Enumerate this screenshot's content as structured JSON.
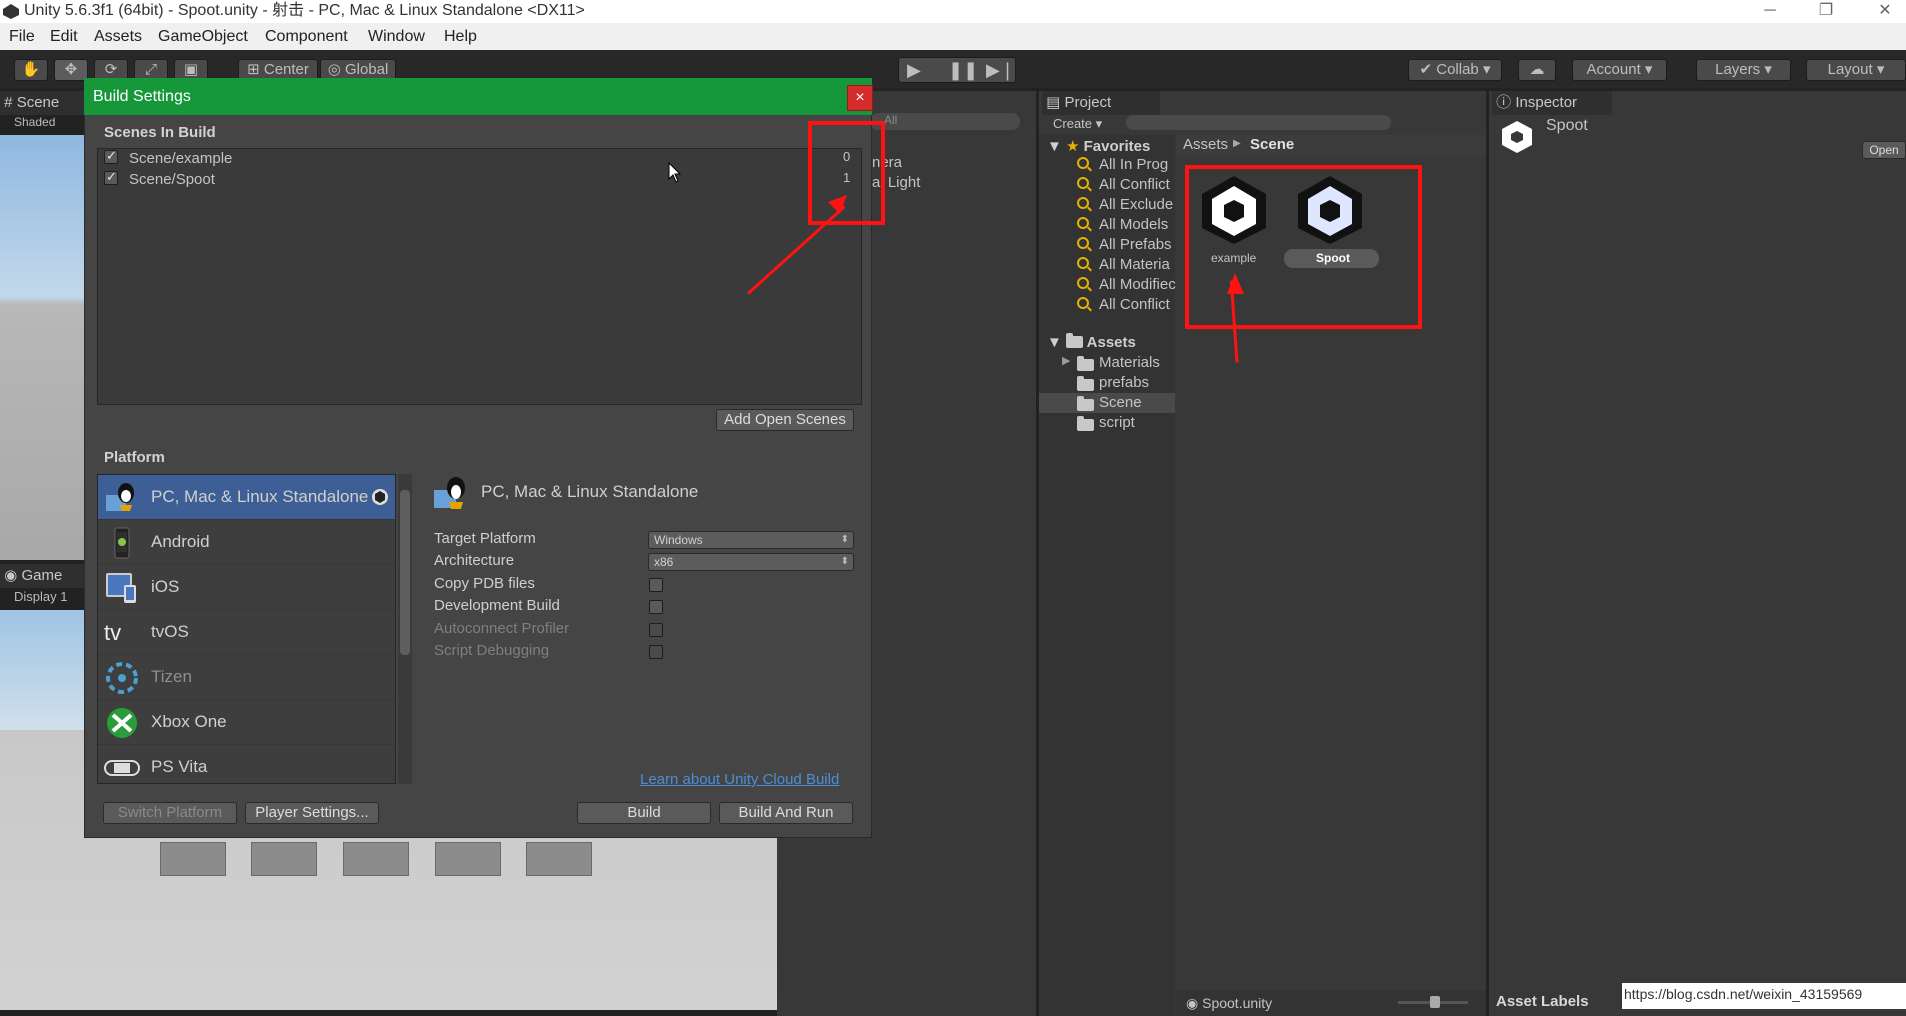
{
  "window": {
    "title": "Unity 5.6.3f1 (64bit) - Spoot.unity - 射击 - PC, Mac & Linux Standalone <DX11>"
  },
  "menu": [
    "File",
    "Edit",
    "Assets",
    "GameObject",
    "Component",
    "Window",
    "Help"
  ],
  "toolbar": {
    "pivot": "Center",
    "space": "Global",
    "collab": "Collab",
    "account": "Account",
    "layers": "Layers",
    "layout": "Layout"
  },
  "scene_tab": {
    "label": "Scene",
    "mode": "Shaded"
  },
  "game_tab": {
    "label": "Game",
    "display": "Display 1"
  },
  "hierarchy": {
    "search_placeholder": "All",
    "items": [
      "nera",
      "al Light"
    ]
  },
  "dialog": {
    "title": "Build Settings",
    "close": "×",
    "scenes_header": "Scenes In Build",
    "scenes": [
      {
        "name": "Scene/example",
        "index": "0",
        "checked": true
      },
      {
        "name": "Scene/Spoot",
        "index": "1",
        "checked": true
      }
    ],
    "add_open_scenes": "Add Open Scenes",
    "platform_header": "Platform",
    "platforms": [
      {
        "name": "PC, Mac & Linux Standalone",
        "selected": true
      },
      {
        "name": "Android",
        "selected": false
      },
      {
        "name": "iOS",
        "selected": false
      },
      {
        "name": "tvOS",
        "selected": false
      },
      {
        "name": "Tizen",
        "selected": false
      },
      {
        "name": "Xbox One",
        "selected": false
      },
      {
        "name": "PS Vita",
        "selected": false
      }
    ],
    "selected_platform_title": "PC, Mac & Linux Standalone",
    "target_platform_label": "Target Platform",
    "target_platform_value": "Windows",
    "architecture_label": "Architecture",
    "architecture_value": "x86",
    "copy_pdb_label": "Copy PDB files",
    "dev_build_label": "Development Build",
    "autoconnect_label": "Autoconnect Profiler",
    "script_debug_label": "Script Debugging",
    "cloud_link": "Learn about Unity Cloud Build",
    "switch_platform": "Switch Platform",
    "player_settings": "Player Settings...",
    "build": "Build",
    "build_and_run": "Build And Run"
  },
  "project": {
    "tab": "Project",
    "create": "Create",
    "favorites_label": "Favorites",
    "favorites": [
      "All In Prog",
      "All Conflict",
      "All Exclude",
      "All Models",
      "All Prefabs",
      "All Materia",
      "All Modifiec",
      "All Conflict"
    ],
    "assets_label": "Assets",
    "folders": [
      "Materials",
      "prefabs",
      "Scene",
      "script"
    ],
    "breadcrumb_root": "Assets",
    "breadcrumb_current": "Scene",
    "assets": [
      "example",
      "Spoot"
    ],
    "footer_file": "Spoot.unity"
  },
  "inspector": {
    "tab": "Inspector",
    "object_name": "Spoot",
    "open_button": "Open",
    "asset_labels": "Asset Labels"
  },
  "watermark": "https://blog.csdn.net/weixin_43159569"
}
